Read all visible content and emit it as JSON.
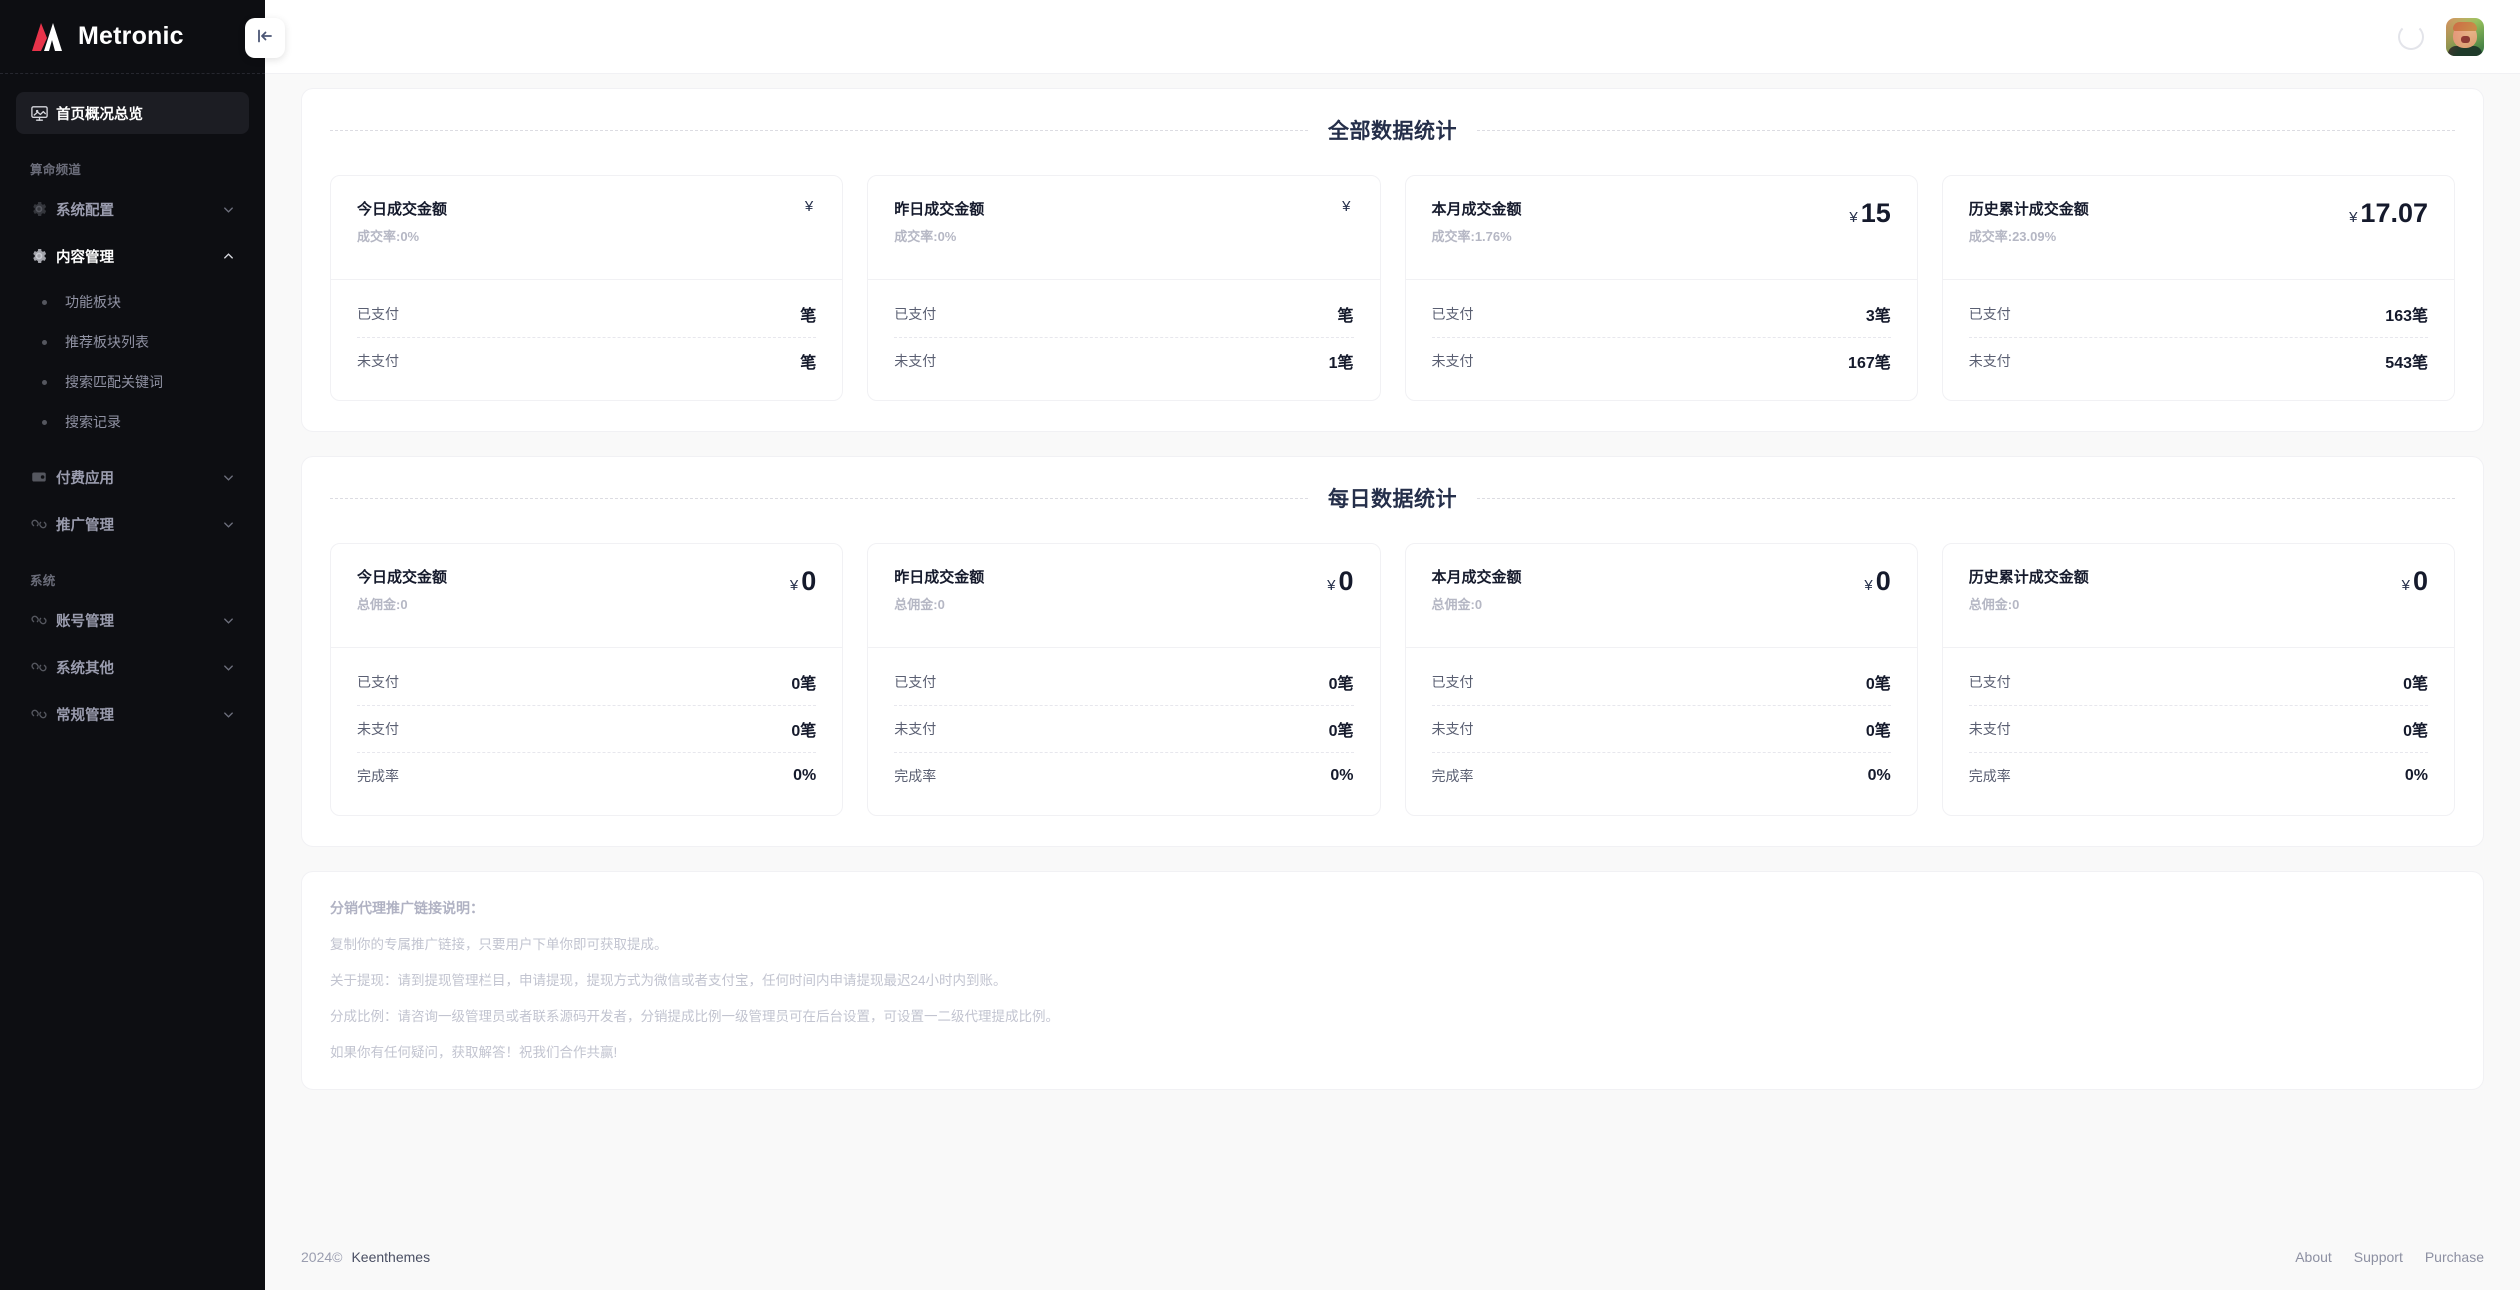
{
  "sidebar": {
    "brand": "Metronic",
    "logo_icon": "metronic-logo-icon",
    "collapse_icon": "collapse-left-icon",
    "home": {
      "label": "首页概况总览",
      "icon": "monitor-icon"
    },
    "groups": [
      {
        "section": "算命频道",
        "items": [
          {
            "label": "系统配置",
            "icon": "gear-icon",
            "arrow": "chevron-down-icon",
            "expanded": false,
            "children": []
          },
          {
            "label": "内容管理",
            "icon": "gear-icon",
            "arrow": "chevron-up-icon",
            "expanded": true,
            "children": [
              {
                "label": "功能板块"
              },
              {
                "label": "推荐板块列表"
              },
              {
                "label": "搜索匹配关键词"
              },
              {
                "label": "搜索记录"
              }
            ]
          },
          {
            "label": "付费应用",
            "icon": "wallet-icon",
            "arrow": "chevron-down-icon",
            "expanded": false,
            "children": []
          },
          {
            "label": "推广管理",
            "icon": "link-icon",
            "arrow": "chevron-down-icon",
            "expanded": false,
            "children": []
          }
        ]
      },
      {
        "section": "系统",
        "items": [
          {
            "label": "账号管理",
            "icon": "link-icon",
            "arrow": "chevron-down-icon",
            "expanded": false,
            "children": []
          },
          {
            "label": "系统其他",
            "icon": "link-icon",
            "arrow": "chevron-down-icon",
            "expanded": false,
            "children": []
          },
          {
            "label": "常规管理",
            "icon": "link-icon",
            "arrow": "chevron-down-icon",
            "expanded": false,
            "children": []
          }
        ]
      }
    ]
  },
  "topbar": {
    "spinner_icon": "loading-spinner-icon",
    "avatar_icon": "user-avatar"
  },
  "sections": [
    {
      "title": "全部数据统计",
      "row_labels": [
        "已支付",
        "未支付"
      ],
      "cards": [
        {
          "title": "今日成交金额",
          "sub": "成交率:0%",
          "currency": "¥",
          "amount": "",
          "rows": [
            {
              "label": "已支付",
              "value": "笔"
            },
            {
              "label": "未支付",
              "value": "笔"
            }
          ]
        },
        {
          "title": "昨日成交金额",
          "sub": "成交率:0%",
          "currency": "¥",
          "amount": "",
          "rows": [
            {
              "label": "已支付",
              "value": "笔"
            },
            {
              "label": "未支付",
              "value": "1笔"
            }
          ]
        },
        {
          "title": "本月成交金额",
          "sub": "成交率:1.76%",
          "currency": "¥",
          "amount": "15",
          "rows": [
            {
              "label": "已支付",
              "value": "3笔"
            },
            {
              "label": "未支付",
              "value": "167笔"
            }
          ]
        },
        {
          "title": "历史累计成交金额",
          "sub": "成交率:23.09%",
          "currency": "¥",
          "amount": "17.07",
          "rows": [
            {
              "label": "已支付",
              "value": "163笔"
            },
            {
              "label": "未支付",
              "value": "543笔"
            }
          ]
        }
      ]
    },
    {
      "title": "每日数据统计",
      "row_labels": [
        "已支付",
        "未支付",
        "完成率"
      ],
      "cards": [
        {
          "title": "今日成交金额",
          "sub": "总佣金:0",
          "currency": "¥",
          "amount": "0",
          "rows": [
            {
              "label": "已支付",
              "value": "0笔"
            },
            {
              "label": "未支付",
              "value": "0笔"
            },
            {
              "label": "完成率",
              "value": "0%"
            }
          ]
        },
        {
          "title": "昨日成交金额",
          "sub": "总佣金:0",
          "currency": "¥",
          "amount": "0",
          "rows": [
            {
              "label": "已支付",
              "value": "0笔"
            },
            {
              "label": "未支付",
              "value": "0笔"
            },
            {
              "label": "完成率",
              "value": "0%"
            }
          ]
        },
        {
          "title": "本月成交金额",
          "sub": "总佣金:0",
          "currency": "¥",
          "amount": "0",
          "rows": [
            {
              "label": "已支付",
              "value": "0笔"
            },
            {
              "label": "未支付",
              "value": "0笔"
            },
            {
              "label": "完成率",
              "value": "0%"
            }
          ]
        },
        {
          "title": "历史累计成交金额",
          "sub": "总佣金:0",
          "currency": "¥",
          "amount": "0",
          "rows": [
            {
              "label": "已支付",
              "value": "0笔"
            },
            {
              "label": "未支付",
              "value": "0笔"
            },
            {
              "label": "完成率",
              "value": "0%"
            }
          ]
        }
      ]
    }
  ],
  "notes": {
    "title": "分销代理推广链接说明：",
    "lines": [
      "复制你的专属推广链接，只要用户下单你即可获取提成。",
      "关于提现：请到提现管理栏目，申请提现，提现方式为微信或者支付宝，任何时间内申请提现最迟24小时内到账。",
      "分成比例：请咨询一级管理员或者联系源码开发者，分销提成比例一级管理员可在后台设置，可设置一二级代理提成比例。",
      "如果你有任何疑问，获取解答！祝我们合作共赢!"
    ]
  },
  "footer": {
    "year": "2024©",
    "brand": "Keenthemes",
    "links": [
      "About",
      "Support",
      "Purchase"
    ]
  },
  "colors": {
    "sidebar_bg": "#0d0e12",
    "accent_red": "#e8334a",
    "text_dark": "#151a2c",
    "muted": "#b5b7c4"
  }
}
